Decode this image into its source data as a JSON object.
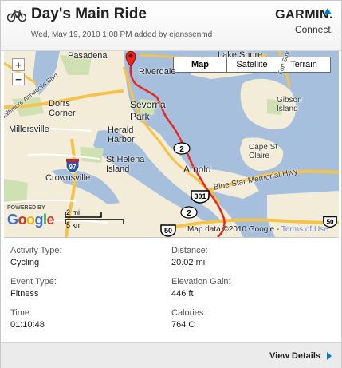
{
  "header": {
    "title": "Day's Main Ride",
    "meta": "Wed, May 19, 2010 1:08 PM added by ejanssenmd",
    "icon": "bicycle-icon"
  },
  "logo": {
    "brand": "GARMIN.",
    "product": "Connect."
  },
  "map": {
    "types": [
      {
        "label": "Map",
        "active": true
      },
      {
        "label": "Satellite",
        "active": false
      },
      {
        "label": "Terrain",
        "active": false
      }
    ],
    "zoom_in": "+",
    "zoom_out": "−",
    "places": {
      "pasadena": "Pasadena",
      "lake_shore": "Lake Shore",
      "riverdale": "Riverdale",
      "dorrs_corner": "Dorrs\nCorner",
      "severna_park": "Severna\nPark",
      "millersville": "Millersville",
      "herald_harbor": "Herald\nHarbor",
      "gibson_island": "Gibson\nIsland",
      "cape_st_claire": "Cape St\nClaire",
      "st_helena_island": "St Helena\nIsland",
      "crownsville": "Crownsville",
      "arnold": "Arnold",
      "blue_star": "Blue Star Memorial Hwy",
      "fort_smallwood": "Fort Smallwood Rd",
      "baltimore_hwy": "Baltimore Annapolis Blvd"
    },
    "shields": {
      "r2a": "2",
      "r2b": "2",
      "i97": "97",
      "r301": "301",
      "r50a": "50",
      "r50b": "50"
    },
    "powered_by": "POWERED BY",
    "google": [
      "G",
      "o",
      "o",
      "g",
      "l",
      "e"
    ],
    "google_colors": [
      "#3a6fd8",
      "#d53326",
      "#f1b500",
      "#3a6fd8",
      "#29a04a",
      "#d53326"
    ],
    "scale_miles": "2 mi",
    "scale_km": "5 km",
    "attribution": "Map data ©2010 Google - ",
    "terms": "Terms of Use"
  },
  "stats": {
    "activity_type": {
      "label": "Activity Type:",
      "value": "Cycling"
    },
    "event_type": {
      "label": "Event Type:",
      "value": "Fitness"
    },
    "time": {
      "label": "Time:",
      "value": "01:10:48"
    },
    "distance": {
      "label": "Distance:",
      "value": "20.02 mi"
    },
    "elevation_gain": {
      "label": "Elevation Gain:",
      "value": "446 ft"
    },
    "calories": {
      "label": "Calories:",
      "value": "764 C"
    }
  },
  "footer": {
    "view_details": "View Details"
  },
  "colors": {
    "route": "#e8271f",
    "water": "#a5bfdd",
    "land": "#f3ecd8",
    "park": "#cfe0b2",
    "accent": "#0a79c4"
  }
}
